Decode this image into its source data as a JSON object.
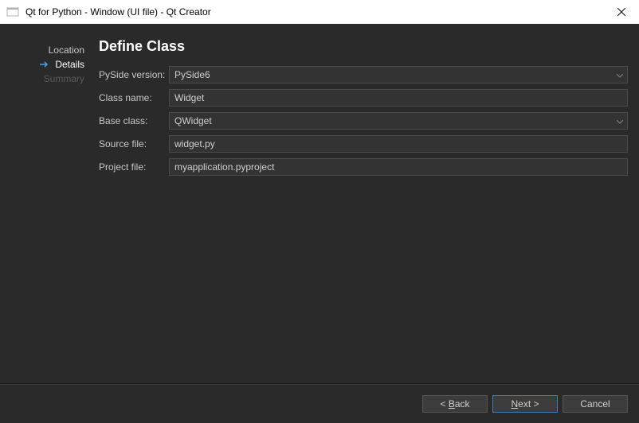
{
  "window": {
    "title": "Qt for Python - Window (UI file) - Qt Creator"
  },
  "sidebar": {
    "steps": [
      {
        "label": "Location"
      },
      {
        "label": "Details"
      },
      {
        "label": "Summary"
      }
    ]
  },
  "heading": "Define Class",
  "form": {
    "pyside_label": "PySide version:",
    "pyside_value": "PySide6",
    "class_label": "Class name:",
    "class_value": "Widget",
    "base_label": "Base class:",
    "base_value": "QWidget",
    "source_label": "Source file:",
    "source_value": "widget.py",
    "project_label": "Project file:",
    "project_value": "myapplication.pyproject"
  },
  "buttons": {
    "back": "< Back",
    "next": "Next >",
    "cancel": "Cancel"
  }
}
